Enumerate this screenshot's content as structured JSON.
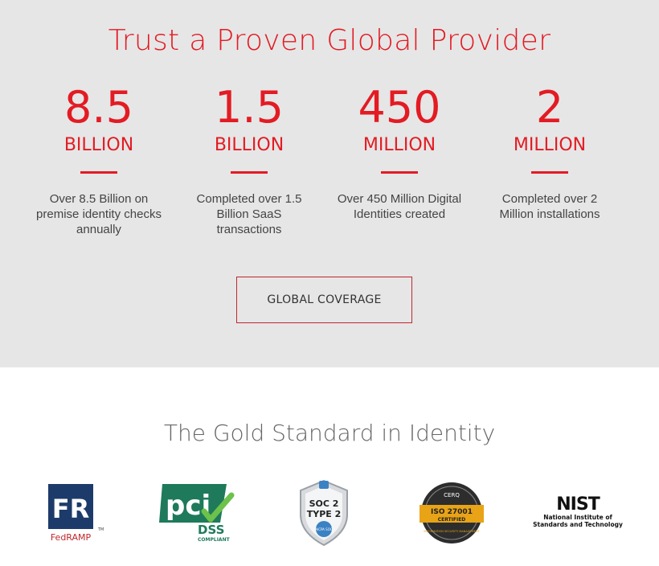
{
  "stats": {
    "title": "Trust a Proven Global Provider",
    "items": [
      {
        "number": "8.5",
        "unit": "BILLION",
        "desc": "Over 8.5 Billion on premise identity checks annually"
      },
      {
        "number": "1.5",
        "unit": "BILLION",
        "desc": "Completed over 1.5 Billion SaaS transactions"
      },
      {
        "number": "450",
        "unit": "MILLION",
        "desc": "Over 450 Million Digital Identities created"
      },
      {
        "number": "2",
        "unit": "MILLION",
        "desc": "Completed over 2 Million installations"
      }
    ],
    "button_label": "GLOBAL COVERAGE"
  },
  "certifications": {
    "title": "The Gold Standard in Identity",
    "logos": [
      {
        "name": "FedRAMP",
        "mark": "FR",
        "tm": "TM"
      },
      {
        "name": "PCI DSS",
        "mark": "pci",
        "sub": "DSS",
        "note": "COMPLIANT"
      },
      {
        "name": "SOC 2 Type 2",
        "line1": "SOC 2",
        "line2": "TYPE 2",
        "badge": "AICPA SOC"
      },
      {
        "name": "ISO 27001 Certified",
        "top": "CERQ",
        "line1": "ISO 27001",
        "line2": "CERTIFIED",
        "note": "INFORMATION SECURITY MANAGEMENT"
      },
      {
        "name": "NIST",
        "mark": "NIST",
        "line1": "National Institute of",
        "line2": "Standards and Technology"
      }
    ]
  },
  "colors": {
    "accent": "#e31b23",
    "section_bg": "#e6e6e6"
  }
}
